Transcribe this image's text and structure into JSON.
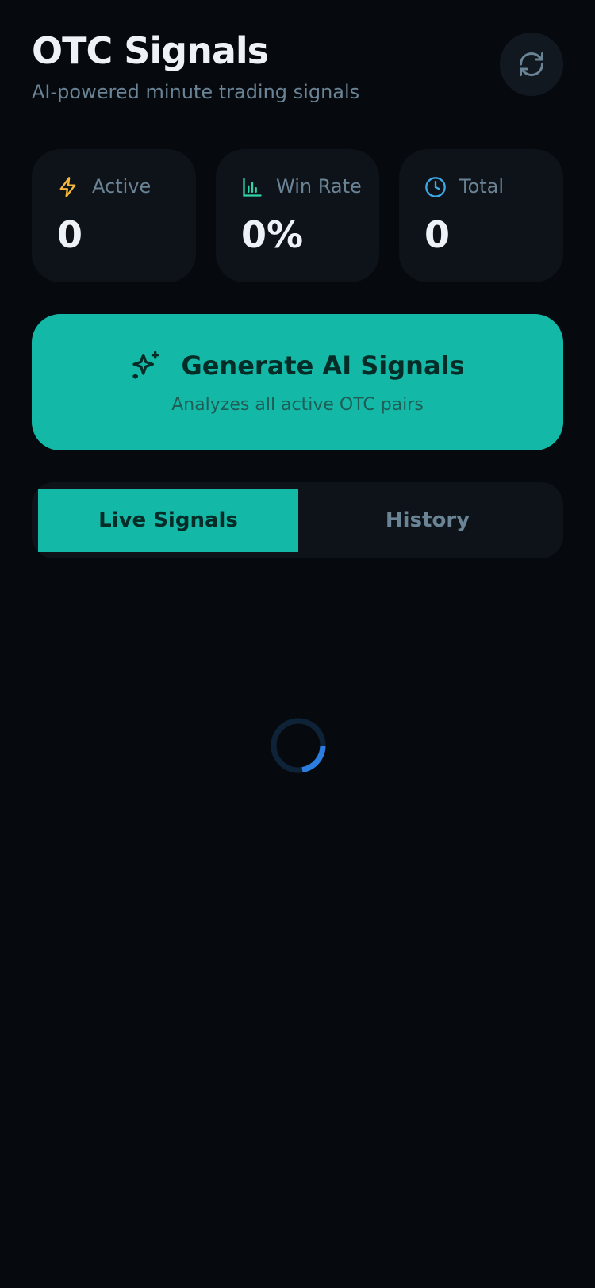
{
  "header": {
    "title": "OTC Signals",
    "subtitle": "AI-powered minute trading signals",
    "refresh_icon": "refresh-icon"
  },
  "stats": [
    {
      "label": "Active",
      "value": "0",
      "icon": "lightning-icon",
      "icon_color": "#f5b73a"
    },
    {
      "label": "Win Rate",
      "value": "0%",
      "icon": "bar-chart-icon",
      "icon_color": "#2fd3a8"
    },
    {
      "label": "Total",
      "value": "0",
      "icon": "clock-icon",
      "icon_color": "#3ea7e8"
    }
  ],
  "generate": {
    "label": "Generate AI Signals",
    "sublabel": "Analyzes all active OTC pairs",
    "icon": "sparkle-icon"
  },
  "tabs": {
    "items": [
      {
        "label": "Live Signals",
        "active": true
      },
      {
        "label": "History",
        "active": false
      }
    ]
  },
  "colors": {
    "background": "#060a0f",
    "card": "#0e1319",
    "accent": "#14b8a6",
    "muted_text": "#6a8395",
    "spinner": "#2b7de0"
  }
}
